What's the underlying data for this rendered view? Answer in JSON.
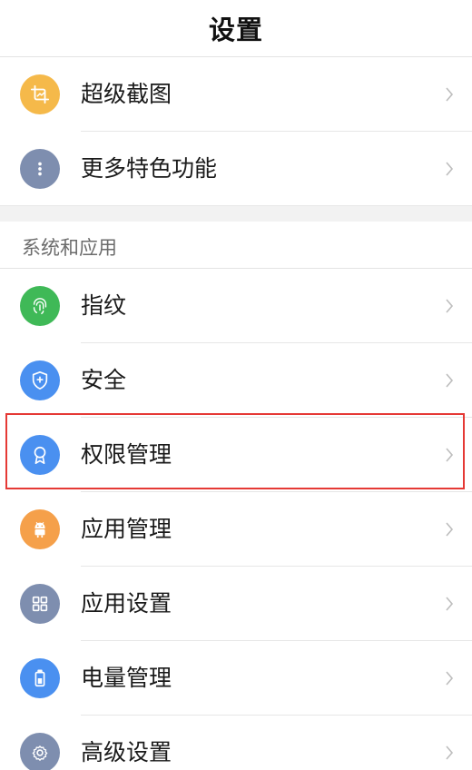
{
  "header": {
    "title": "设置"
  },
  "top_items": [
    {
      "label": "超级截图",
      "icon": "crop-icon",
      "color": "#F5B94A"
    },
    {
      "label": "更多特色功能",
      "icon": "more-dots-icon",
      "color": "#7E8EAF"
    }
  ],
  "section": {
    "title": "系统和应用",
    "items": [
      {
        "label": "指纹",
        "icon": "fingerprint-icon",
        "color": "#3FB957"
      },
      {
        "label": "安全",
        "icon": "shield-icon",
        "color": "#4A90F0"
      },
      {
        "label": "权限管理",
        "icon": "badge-icon",
        "color": "#4A90F0",
        "highlighted": true
      },
      {
        "label": "应用管理",
        "icon": "android-icon",
        "color": "#F5A04A"
      },
      {
        "label": "应用设置",
        "icon": "grid-icon",
        "color": "#7E8EAF"
      },
      {
        "label": "电量管理",
        "icon": "battery-icon",
        "color": "#4A90F0"
      },
      {
        "label": "高级设置",
        "icon": "gear-icon",
        "color": "#7E8EAF"
      }
    ]
  },
  "colors": {
    "highlight_border": "#E53935",
    "chevron": "#BDBDBD"
  }
}
